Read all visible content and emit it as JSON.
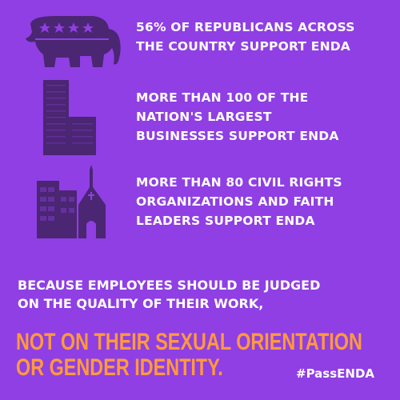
{
  "colors": {
    "background": "#8f3fe3",
    "icon": "#4b2673",
    "text": "#ffffff",
    "accent": "#ff9a3c"
  },
  "facts": [
    {
      "icon": "elephant-icon",
      "lines": [
        "56% OF REPUBLICANS ACROSS",
        "THE COUNTRY SUPPORT ENDA"
      ]
    },
    {
      "icon": "skyscrapers-icon",
      "lines": [
        "MORE THAN 100 OF THE",
        "NATION'S LARGEST",
        "BUSINESSES SUPPORT ENDA"
      ]
    },
    {
      "icon": "buildings-church-icon",
      "lines": [
        "MORE THAN 80 CIVIL RIGHTS",
        "ORGANIZATIONS AND FAITH",
        "LEADERS SUPPORT ENDA"
      ]
    }
  ],
  "statement": {
    "lines": [
      "BECAUSE EMPLOYEES SHOULD BE JUDGED",
      "ON THE QUALITY OF THEIR WORK,"
    ]
  },
  "emphasis": {
    "lines": [
      "NOT ON THEIR SEXUAL ORIENTATION",
      "OR GENDER IDENTITY."
    ]
  },
  "hashtag": "#PassENDA"
}
